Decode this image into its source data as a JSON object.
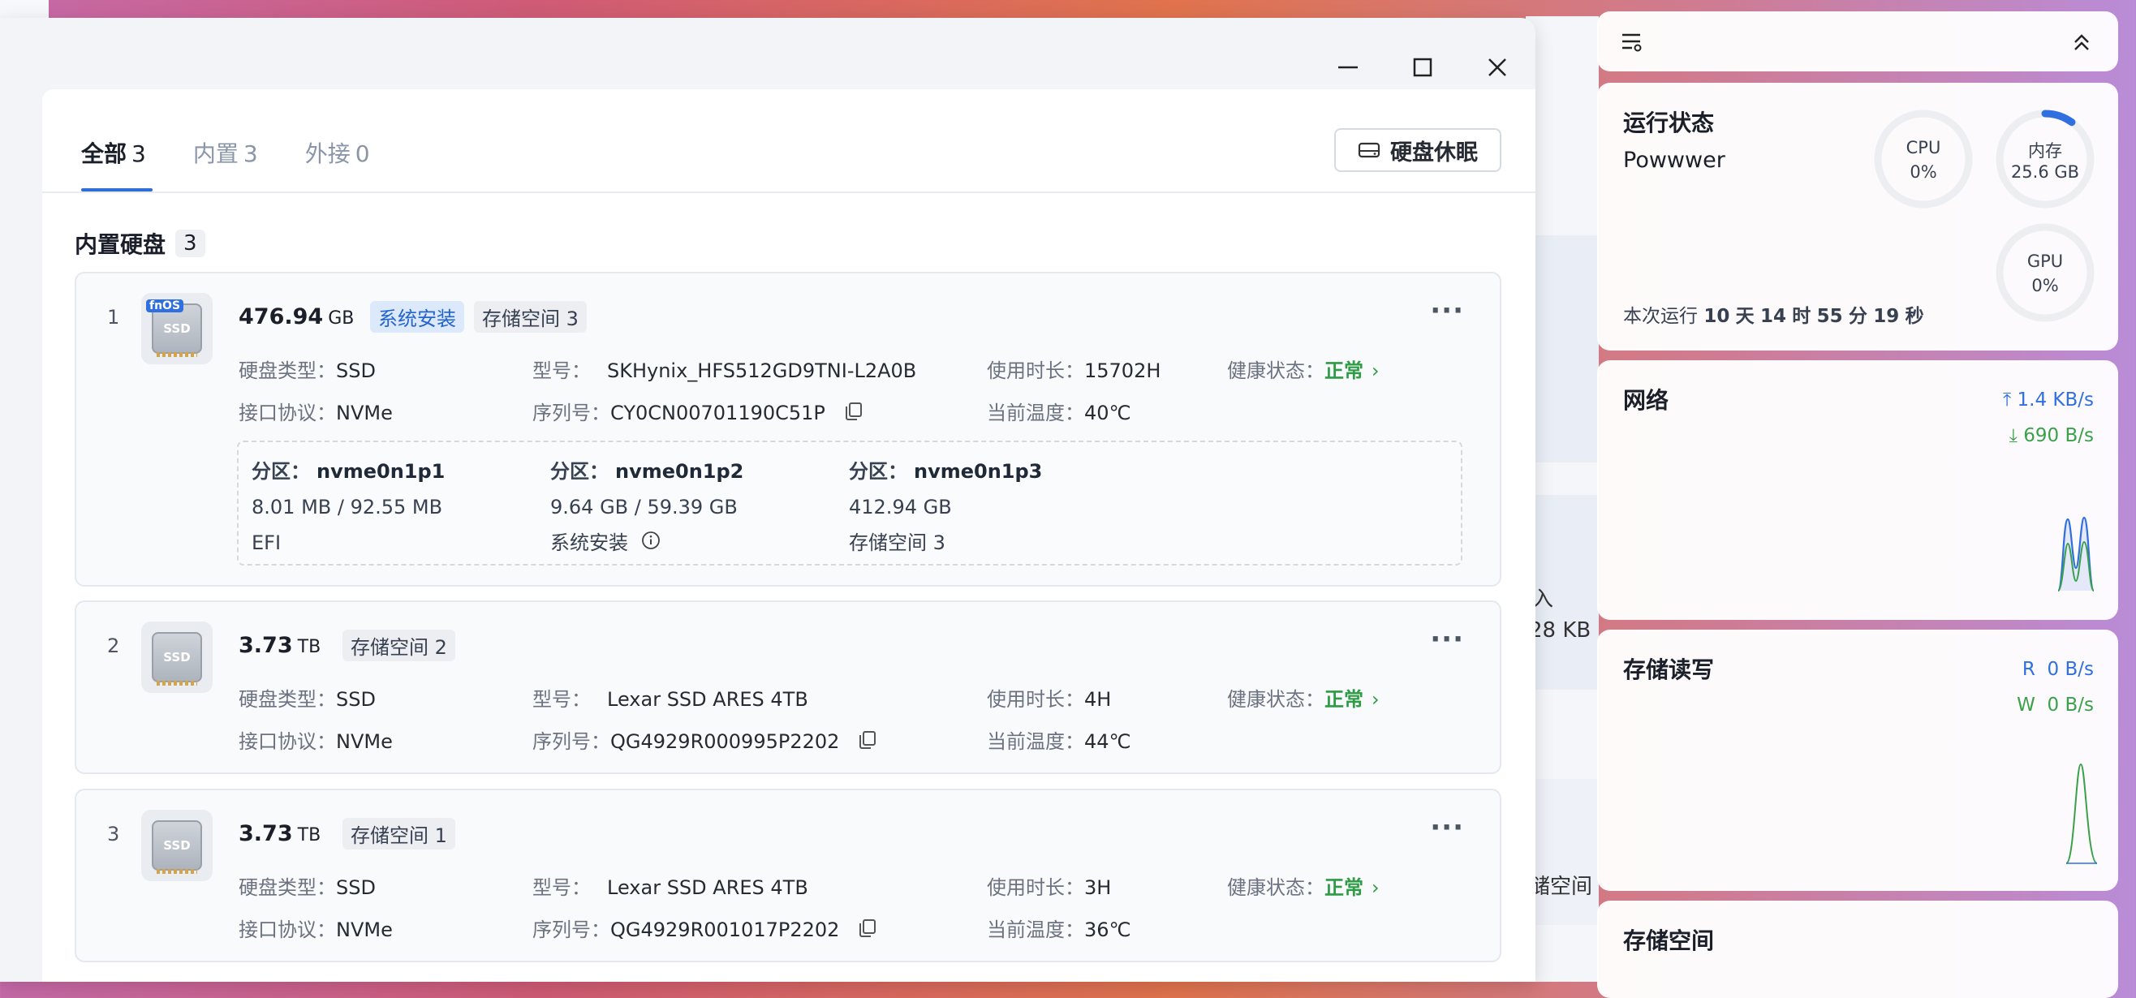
{
  "window": {
    "minimize": "minimize",
    "maximize": "maximize",
    "close": "close"
  },
  "tabs": [
    {
      "label": "全部",
      "count": "3"
    },
    {
      "label": "内置",
      "count": "3"
    },
    {
      "label": "外接",
      "count": "0"
    }
  ],
  "sleep_button": "硬盘休眠",
  "section": {
    "title": "内置硬盘",
    "count": "3"
  },
  "labels": {
    "type": "硬盘类型：",
    "model": "型号：",
    "uptime": "使用时长：",
    "health": "健康状态：",
    "protocol": "接口协议：",
    "serial": "序列号：",
    "temp": "当前温度：",
    "partition": "分区："
  },
  "disks": [
    {
      "index": "1",
      "fnos": "fnOS",
      "icon_text": "SSD",
      "capacity": "476.94",
      "unit": "GB",
      "tags": [
        "系统安装",
        "存储空间 3"
      ],
      "type": "SSD",
      "model": "SKHynix_HFS512GD9TNI-L2A0B",
      "uptime": "15702H",
      "health": "正常",
      "protocol": "NVMe",
      "serial": "CY0CN00701190C51P",
      "temp": "40℃",
      "partitions": [
        {
          "name": "nvme0n1p1",
          "size": "8.01 MB / 92.55 MB",
          "use": "EFI"
        },
        {
          "name": "nvme0n1p2",
          "size": "9.64 GB / 59.39 GB",
          "use": "系统安装"
        },
        {
          "name": "nvme0n1p3",
          "size": "412.94 GB",
          "use": "存储空间 3"
        }
      ]
    },
    {
      "index": "2",
      "icon_text": "SSD",
      "capacity": "3.73",
      "unit": "TB",
      "tags": [
        "存储空间 2"
      ],
      "type": "SSD",
      "model": "Lexar SSD ARES 4TB",
      "uptime": "4H",
      "health": "正常",
      "protocol": "NVMe",
      "serial": "QG4929R000995P2202",
      "temp": "44℃"
    },
    {
      "index": "3",
      "icon_text": "SSD",
      "capacity": "3.73",
      "unit": "TB",
      "tags": [
        "存储空间 1"
      ],
      "type": "SSD",
      "model": "Lexar SSD ARES 4TB",
      "uptime": "3H",
      "health": "正常",
      "protocol": "NVMe",
      "serial": "QG4929R001017P2202",
      "temp": "36℃"
    }
  ],
  "behind": {
    "t1": "入",
    "t2": "28 KB",
    "t3": "储空间"
  },
  "widgets": {
    "status": {
      "title": "运行状态",
      "host": "Powwwer",
      "cpu_label": "CPU",
      "cpu_value": "0%",
      "cpu_level": 0,
      "mem_label": "内存",
      "mem_value": "25.6 GB",
      "mem_level": 0.1,
      "gpu_label": "GPU",
      "gpu_value": "0%",
      "gpu_level": 0,
      "uptime_prefix": "本次运行",
      "uptime_days": "10",
      "d": "天",
      "uptime_hours": "14",
      "h": "时",
      "uptime_min": "55",
      "m": "分",
      "uptime_sec": "19",
      "s": "秒"
    },
    "network": {
      "title": "网络",
      "up": "1.4 KB/s",
      "down": "690 B/s"
    },
    "storage_io": {
      "title": "存储读写",
      "r_label": "R",
      "r": "0 B/s",
      "w_label": "W",
      "w": "0 B/s"
    },
    "storage": {
      "title": "存储空间"
    }
  },
  "colors": {
    "accent": "#2d6fd6",
    "ok": "#2e9b45",
    "read": "#2f6fe0",
    "write": "#3aa14a"
  }
}
